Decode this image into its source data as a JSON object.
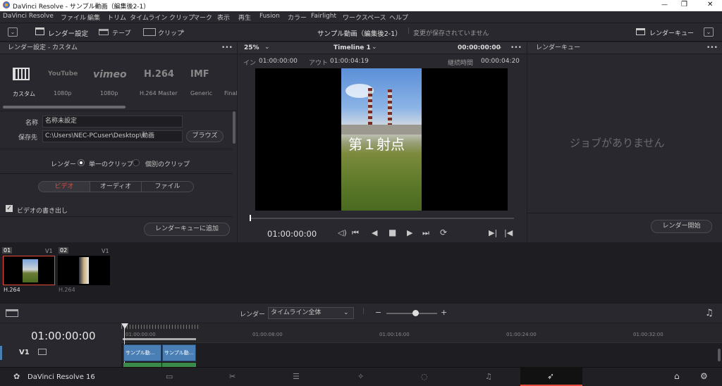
{
  "window": {
    "title": "DaVinci Resolve - サンプル動画（編集後2-1）",
    "min": "—",
    "max": "❐",
    "close": "✕"
  },
  "menu": [
    "DaVinci Resolve",
    "ファイル",
    "編集",
    "トリム",
    "タイムライン",
    "クリップ",
    "マーク",
    "表示",
    "再生",
    "Fusion",
    "カラー",
    "Fairlight",
    "ワークスペース",
    "ヘルプ"
  ],
  "toolbar": {
    "render_settings": "レンダー設定",
    "tape": "テープ",
    "clips": "クリップ",
    "project_title": "サンプル動画（編集後2-1）",
    "unsaved": "変更が保存されていません",
    "render_queue": "レンダーキュー"
  },
  "render_panel": {
    "title": "レンダー設定 - カスタム",
    "more": "•••",
    "presets": [
      {
        "brand": "",
        "label": "カスタム"
      },
      {
        "brand": "YouTube",
        "label": "1080p"
      },
      {
        "brand": "vimeo",
        "label": "1080p"
      },
      {
        "brand": "H.264",
        "label": "H.264 Master"
      },
      {
        "brand": "IMF",
        "label": "Generic"
      },
      {
        "brand": "",
        "label": "Final"
      }
    ],
    "name_label": "名称",
    "name_value": "名称未設定",
    "location_label": "保存先",
    "location_value": "C:\\Users\\NEC-PCuser\\Desktop\\動画",
    "browse": "ブラウズ",
    "render_label": "レンダー",
    "single_clip": "単一のクリップ",
    "individual_clips": "個別のクリップ",
    "tabs": [
      "ビデオ",
      "オーディオ",
      "ファイル"
    ],
    "export_video": "ビデオの書き出し",
    "add_to_queue": "レンダーキューに追加"
  },
  "viewer": {
    "zoom": "25%",
    "timeline_name": "Timeline 1",
    "timecode_top": "00:00:00:00",
    "in_label": "イン",
    "in_value": "01:00:00:00",
    "out_label": "アウト",
    "out_value": "01:00:04:19",
    "duration_label": "継続時間",
    "duration_value": "00:00:04:20",
    "overlay_text": "第１射点",
    "current_tc": "01:00:00:00"
  },
  "queue": {
    "title": "レンダーキュー",
    "empty": "ジョブがありません",
    "start": "レンダー開始"
  },
  "clips": [
    {
      "num": "01",
      "track": "V1",
      "codec": "H.264"
    },
    {
      "num": "02",
      "track": "V1",
      "codec": "H.264"
    }
  ],
  "timeline_bar": {
    "render_label": "レンダー",
    "render_option": "タイムライン全体"
  },
  "timeline": {
    "timecode": "01:00:00:00",
    "ruler": [
      "01:00:00:00",
      "01:00:08:00",
      "01:00:16:00",
      "01:00:24:00",
      "01:00:32:00"
    ],
    "track": "V1",
    "clip_labels": [
      "サンプル動...",
      "サンプル動..."
    ]
  },
  "bottom": {
    "app": "DaVinci Resolve 16"
  },
  "colors": {
    "accent": "#e64b3c",
    "clip_blue": "#4a7fb5",
    "clip_green": "#3a8a4a",
    "active_page": "#e64b3c"
  }
}
